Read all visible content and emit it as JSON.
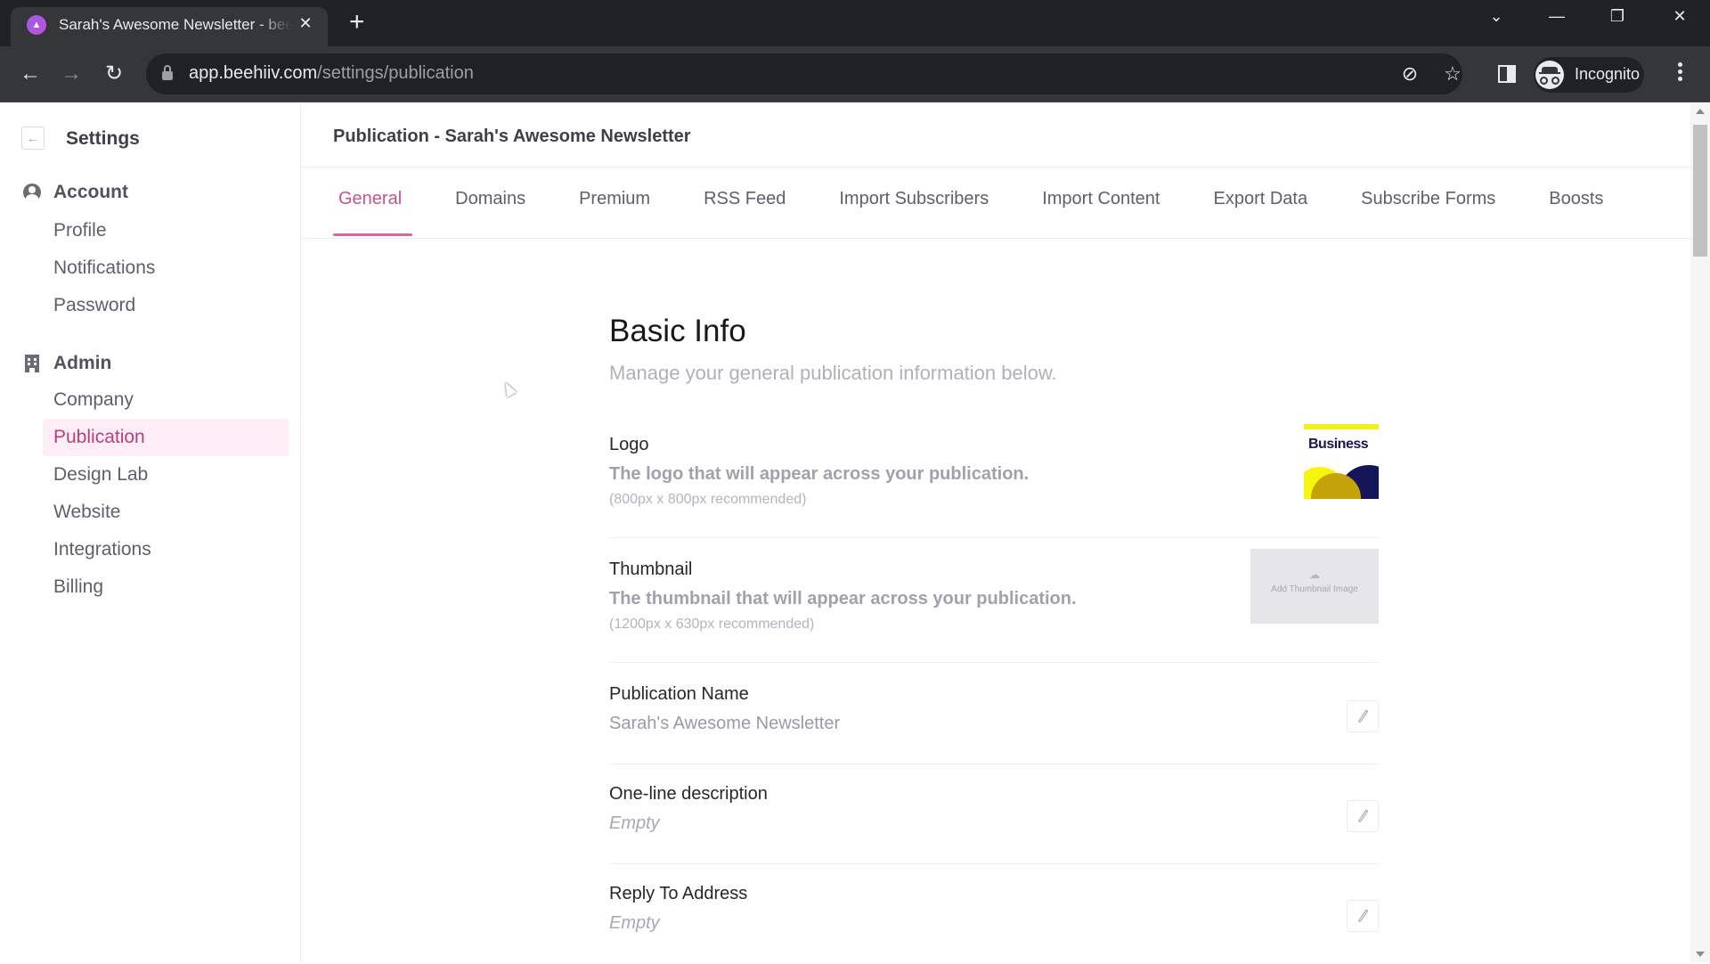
{
  "browser": {
    "tab_title": "Sarah's Awesome Newsletter - beehiiv",
    "tab_favicon": "beehiiv-logo-icon",
    "url_domain": "app.beehiiv.com",
    "url_path": "/settings/publication",
    "profile_label": "Incognito",
    "icons": {
      "close_tab": "✕",
      "new_tab": "+",
      "back": "←",
      "forward": "→",
      "reload": "↻",
      "tab_search": "⌄",
      "minimize": "—",
      "restore": "❐",
      "close_window": "✕",
      "eye_off": "⊘",
      "star": "☆"
    }
  },
  "sidebar": {
    "back_icon": "←",
    "title": "Settings",
    "groups": [
      {
        "label": "Account",
        "icon": "user-circle-icon",
        "items": [
          {
            "label": "Profile",
            "active": false
          },
          {
            "label": "Notifications",
            "active": false
          },
          {
            "label": "Password",
            "active": false
          }
        ]
      },
      {
        "label": "Admin",
        "icon": "building-icon",
        "items": [
          {
            "label": "Company",
            "active": false
          },
          {
            "label": "Publication",
            "active": true
          },
          {
            "label": "Design Lab",
            "active": false
          },
          {
            "label": "Website",
            "active": false
          },
          {
            "label": "Integrations",
            "active": false
          },
          {
            "label": "Billing",
            "active": false
          }
        ]
      }
    ]
  },
  "main": {
    "header": "Publication - Sarah's Awesome Newsletter",
    "tabs": [
      {
        "label": "General",
        "active": true
      },
      {
        "label": "Domains",
        "active": false
      },
      {
        "label": "Premium",
        "active": false
      },
      {
        "label": "RSS Feed",
        "active": false
      },
      {
        "label": "Import Subscribers",
        "active": false
      },
      {
        "label": "Import Content",
        "active": false
      },
      {
        "label": "Export Data",
        "active": false
      },
      {
        "label": "Subscribe Forms",
        "active": false
      },
      {
        "label": "Boosts",
        "active": false
      }
    ],
    "section": {
      "title": "Basic Info",
      "subtitle": "Manage your general publication information below."
    },
    "fields": {
      "logo": {
        "label": "Logo",
        "description": "The logo that will appear across your publication.",
        "hint": "(800px x 800px recommended)",
        "image_text": "Business"
      },
      "thumbnail": {
        "label": "Thumbnail",
        "description": "The thumbnail that will appear across your publication.",
        "hint": "(1200px x 630px recommended)",
        "placeholder": "Add Thumbnail Image",
        "upload_icon": "☁"
      },
      "publication_name": {
        "label": "Publication Name",
        "value": "Sarah's Awesome Newsletter"
      },
      "one_line_description": {
        "label": "One-line description",
        "value": "Empty"
      },
      "reply_to_address": {
        "label": "Reply To Address",
        "value": "Empty"
      }
    }
  },
  "colors": {
    "accent": "#c0568d",
    "active_nav_bg": "#fdeef5",
    "chrome_dark": "#202124",
    "chrome_toolbar": "#35363a"
  }
}
